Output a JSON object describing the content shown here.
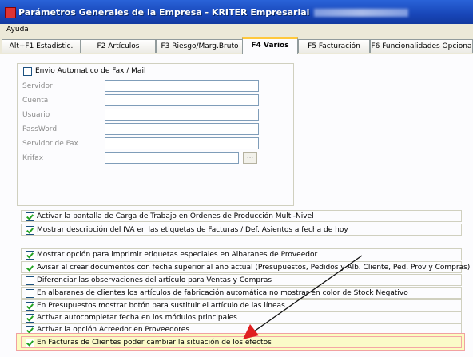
{
  "window": {
    "title": "Parámetros Generales de la Empresa - KRITER Empresarial"
  },
  "menu": {
    "items": [
      {
        "label": "Ayuda"
      }
    ]
  },
  "tabs": [
    {
      "label": "Alt+F1 Estadístic."
    },
    {
      "label": "F2 Artículos"
    },
    {
      "label": "F3 Riesgo/Marg.Bruto"
    },
    {
      "label": "F4 Varios"
    },
    {
      "label": "F5 Facturación"
    },
    {
      "label": "F6 Funcionalidades Opciona"
    }
  ],
  "active_tab": "F4 Varios",
  "fax_group": {
    "checkbox_label": "Envio Automatico de Fax / Mail",
    "checked": false,
    "fields": [
      {
        "label": "Servidor",
        "value": ""
      },
      {
        "label": "Cuenta",
        "value": ""
      },
      {
        "label": "Usuario",
        "value": ""
      },
      {
        "label": "PassWord",
        "value": ""
      },
      {
        "label": "Servidor de Fax",
        "value": ""
      },
      {
        "label": "Krifax",
        "value": ""
      }
    ],
    "browse_label": "..."
  },
  "options": [
    {
      "label": "Activar la pantalla de Carga de Trabajo en Ordenes de Producción Multi-Nivel",
      "checked": true
    },
    {
      "label": "Mostrar descripción del IVA en las etiquetas de Facturas / Def. Asientos a fecha de hoy",
      "checked": true
    },
    {
      "label": "Mostrar opción para imprimir etiquetas especiales en Albaranes de Proveedor",
      "checked": true
    },
    {
      "label": "Avisar al crear documentos con fecha superior al año actual (Presupuestos, Pedidos y  Alb. Cliente, Ped. Prov y Compras)",
      "checked": true
    },
    {
      "label": "Diferenciar las observaciones del artículo para Ventas y Compras",
      "checked": false
    },
    {
      "label": "En albaranes de clientes los artículos de fabricación automática no mostrar en color de Stock Negativo",
      "checked": false
    },
    {
      "label": "En Presupuestos mostrar botón para sustituir el artículo de las líneas",
      "checked": true
    },
    {
      "label": "Activar autocompletar fecha en los módulos principales",
      "checked": true
    },
    {
      "label": "Activar la opción Acreedor en Proveedores",
      "checked": true
    },
    {
      "label": "En Facturas de Clientes poder cambiar la situación de los efectos",
      "checked": true
    }
  ],
  "colors": {
    "title_bar": "#1846b8",
    "active_tab_accent": "#ffc83c",
    "highlight_fill": "#fcfcc0",
    "highlight_border": "#f1a1a1",
    "arrow": "#000000",
    "arrow_head": "#e02020"
  }
}
